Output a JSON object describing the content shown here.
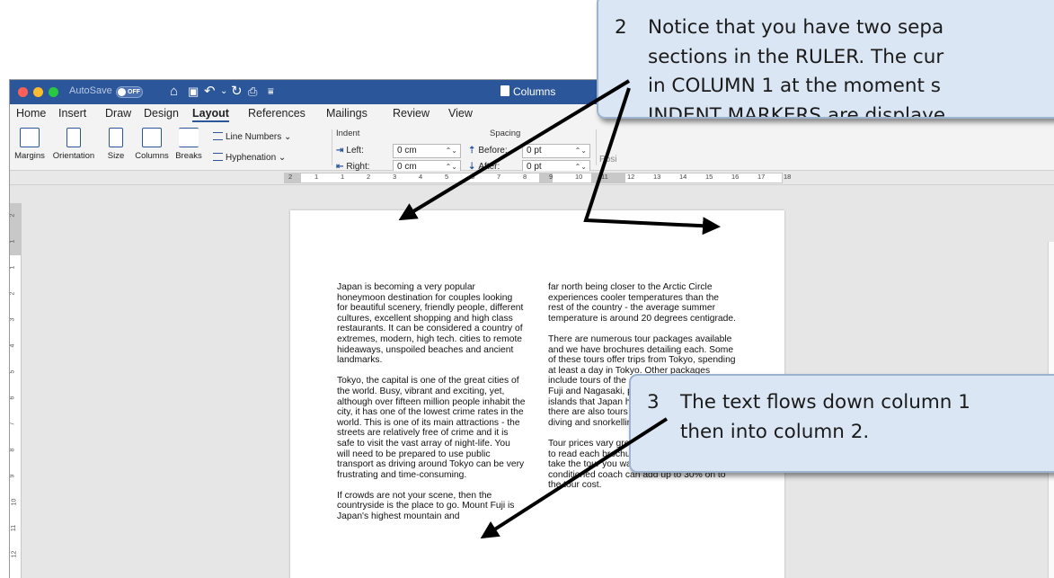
{
  "window": {
    "title": "Columns",
    "autosave_label": "AutoSave",
    "autosave_state": "OFF"
  },
  "ribbon_tabs": [
    "Home",
    "Insert",
    "Draw",
    "Design",
    "Layout",
    "References",
    "Mailings",
    "Review",
    "View"
  ],
  "active_tab": "Layout",
  "ribbon": {
    "page_setup": {
      "margins": "Margins",
      "orientation": "Orientation",
      "size": "Size",
      "columns": "Columns",
      "breaks": "Breaks",
      "line_numbers": "Line Numbers",
      "hyphenation": "Hyphenation"
    },
    "indent": {
      "label": "Indent",
      "left_label": "Left:",
      "left_value": "0 cm",
      "right_label": "Right:",
      "right_value": "0 cm"
    },
    "spacing": {
      "label": "Spacing",
      "before_label": "Before:",
      "before_value": "0 pt",
      "after_label": "After:",
      "after_value": "0 pt"
    },
    "position_partial": "Posi"
  },
  "ruler_numbers": [
    "2",
    "1",
    "1",
    "2",
    "3",
    "4",
    "5",
    "6",
    "7",
    "8",
    "9",
    "10",
    "11",
    "12",
    "13",
    "14",
    "15",
    "16",
    "17",
    "18"
  ],
  "vruler_numbers": [
    "2",
    "1",
    "1",
    "2",
    "3",
    "4",
    "5",
    "6",
    "7",
    "8",
    "9",
    "10",
    "11",
    "12"
  ],
  "document": {
    "column1": [
      "Japan is becoming a very popular honeymoon destination for couples looking for beautiful scenery, friendly people, different cultures, excellent shopping and high class restaurants. It can be considered a country of extremes, modern, high tech. cities to remote hideaways, unspoiled beaches and ancient landmarks.",
      "Tokyo, the capital is one of the great cities of the world.  Busy, vibrant and exciting, yet, although over fifteen million people inhabit the city, it has one of the lowest crime rates in the world.  This is one of its main attractions - the streets are relatively free of crime and it is safe to visit the vast array of night-life.  You will need to be prepared to use public transport as driving around Tokyo can be very frustrating and time-consuming.",
      "If crowds are not your scene, then the countryside is the place to go.  Mount Fuji is Japan's highest mountain and"
    ],
    "column2": [
      "far north being closer to the Arctic Circle experiences cooler temperatures than the rest of the country - the average summer temperature is around 20 degrees centigrade.",
      "There are numerous tour packages available and we have brochures detailing each.  Some of these tours offer trips from Tokyo, spending at least a day in Tokyo.  Other packages include tours of the Japanese Alps, Mount Fuji and Nagasaki, plus numerous coral islands that Japan has.  For the adventurous there are also tours offering trekking, scuba diving and snorkelling.",
      "Tour prices vary greatly, so it is very important to read each brochure carefully so that you take the tour you want.  For instance, an air conditioned coach can add up to 30% on to the tour cost."
    ]
  },
  "callouts": {
    "c2": {
      "number": "2",
      "lines": [
        "Notice that you have two sepa",
        "sections in the RULER.  The cur",
        "in COLUMN 1 at the moment s",
        "INDENT MARKERS are displaye"
      ]
    },
    "c3": {
      "number": "3",
      "lines": [
        "The text flows down column 1",
        "then into column 2."
      ]
    }
  }
}
